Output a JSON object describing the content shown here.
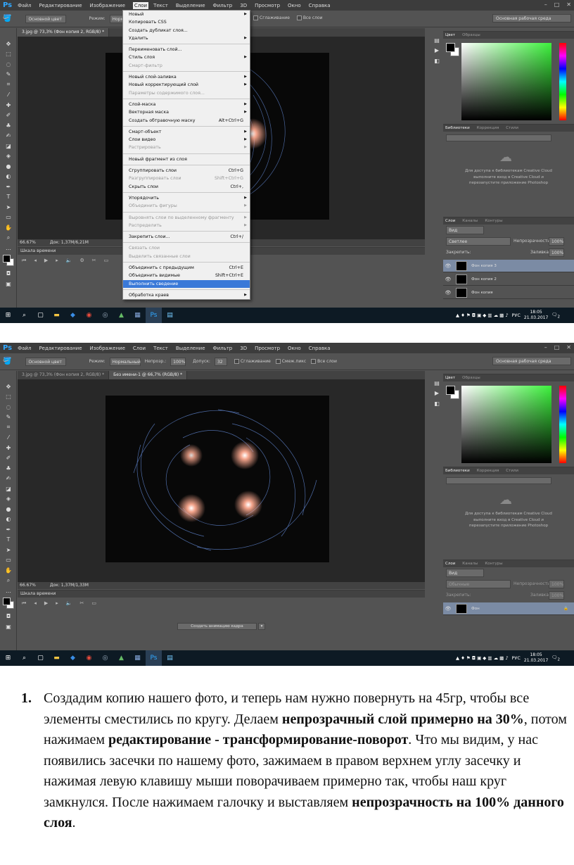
{
  "ps": {
    "logo": "Ps",
    "menu": [
      "Файл",
      "Редактирование",
      "Изображение",
      "Слои",
      "Текст",
      "Выделение",
      "Фильтр",
      "3D",
      "Просмотр",
      "Окно",
      "Справка"
    ],
    "window_buttons": [
      "–",
      "□",
      "✕"
    ]
  },
  "top": {
    "options": {
      "fill_select": "Основной цвет",
      "mode_label": "Режим:",
      "mode_value": "Норм",
      "smoothing_label": "Сглаживание",
      "all_layers_label": "Все слои",
      "workspace": "Основная рабочая среда"
    },
    "tab": "3.jpg @ 73,3% (Фон копия 2, RGB/8) *",
    "zoom": "66.67%",
    "doc_size": "Док: 1,37M/6,21M",
    "timeline_title": "Шкала времени",
    "dropdown": [
      {
        "label": "Новый",
        "arrow": true
      },
      {
        "label": "Копировать CSS"
      },
      {
        "label": "Создать дубликат слоя..."
      },
      {
        "label": "Удалить",
        "arrow": true
      },
      {
        "sep": true
      },
      {
        "label": "Переименовать слой..."
      },
      {
        "label": "Стиль слоя",
        "arrow": true
      },
      {
        "label": "Смарт-фильтр",
        "disabled": true
      },
      {
        "sep": true
      },
      {
        "label": "Новый слой-заливка",
        "arrow": true
      },
      {
        "label": "Новый корректирующий слой",
        "arrow": true
      },
      {
        "label": "Параметры содержимого слоя...",
        "disabled": true
      },
      {
        "sep": true
      },
      {
        "label": "Слой-маска",
        "arrow": true
      },
      {
        "label": "Векторная маска",
        "arrow": true
      },
      {
        "label": "Создать обтравочную маску",
        "shortcut": "Alt+Ctrl+G"
      },
      {
        "sep": true
      },
      {
        "label": "Смарт-объект",
        "arrow": true
      },
      {
        "label": "Слои видео",
        "arrow": true
      },
      {
        "label": "Растрировать",
        "arrow": true,
        "disabled": true
      },
      {
        "sep": true
      },
      {
        "label": "Новый фрагмент из слоя"
      },
      {
        "sep": true
      },
      {
        "label": "Сгруппировать слои",
        "shortcut": "Ctrl+G"
      },
      {
        "label": "Разгруппировать слои",
        "shortcut": "Shift+Ctrl+G",
        "disabled": true
      },
      {
        "label": "Скрыть слои",
        "shortcut": "Ctrl+,"
      },
      {
        "sep": true
      },
      {
        "label": "Упорядочить",
        "arrow": true
      },
      {
        "label": "Объединить фигуры",
        "arrow": true,
        "disabled": true
      },
      {
        "sep": true
      },
      {
        "label": "Выровнять слои по выделенному фрагменту",
        "arrow": true,
        "disabled": true
      },
      {
        "label": "Распределить",
        "arrow": true,
        "disabled": true
      },
      {
        "sep": true
      },
      {
        "label": "Закрепить слои...",
        "shortcut": "Ctrl+/"
      },
      {
        "sep": true
      },
      {
        "label": "Связать слои",
        "disabled": true
      },
      {
        "label": "Выделить связанные слои",
        "disabled": true
      },
      {
        "sep": true
      },
      {
        "label": "Объединить с предыдущим",
        "shortcut": "Ctrl+E"
      },
      {
        "label": "Объединить видимые",
        "shortcut": "Shift+Ctrl+E"
      },
      {
        "label": "Выполнить сведение",
        "highlighted": true
      },
      {
        "sep": true
      },
      {
        "label": "Обработка краев",
        "arrow": true
      }
    ],
    "panels": {
      "color_tabs": [
        "Цвет",
        "Образцы"
      ],
      "lib_tabs": [
        "Библиотеки",
        "Коррекция",
        "Стили"
      ],
      "cc_message": "Для доступа к библиотекам Creative Cloud выполните вход в Creative Cloud и перезапустите приложение Photoshop",
      "layers_tabs": [
        "Слои",
        "Каналы",
        "Контуры"
      ],
      "kind": "Вид",
      "blend": "Светлее",
      "opacity_label": "Непрозрачность:",
      "opacity": "100%",
      "lock_label": "Закрепить:",
      "fill_label": "Заливка:",
      "fill": "100%",
      "layers": [
        {
          "name": "Фон копия 3",
          "selected": true
        },
        {
          "name": "Фон копия 2",
          "selected": false
        },
        {
          "name": "Фон копия",
          "selected": false
        }
      ]
    }
  },
  "bottom": {
    "options": {
      "fill_select": "Основной цвет",
      "mode_label": "Режим:",
      "mode_value": "Нормальный",
      "opacity_label": "Непрозр.:",
      "opacity_value": "100%",
      "tolerance_label": "Допуск:",
      "tolerance_value": "32",
      "smoothing_label": "Сглаживание",
      "contiguous_label": "Смеж.пикс",
      "all_layers_label": "Все слои",
      "workspace": "Основная рабочая среда"
    },
    "tabs": [
      "3.jpg @ 73,3% (Фон копия 2, RGB/8) *",
      "Без имени-1 @ 66,7% (RGB/8) *"
    ],
    "zoom": "66.67%",
    "doc_size": "Док: 1,37M/1,33M",
    "timeline_title": "Шкала времени",
    "create_frames": "Создать анимацию кадра",
    "panels": {
      "color_tabs": [
        "Цвет",
        "Образцы"
      ],
      "lib_tabs": [
        "Библиотеки",
        "Коррекция",
        "Стили"
      ],
      "cc_message": "Для доступа к библиотекам Creative Cloud выполните вход в Creative Cloud и перезапустите приложение Photoshop",
      "layers_tabs": [
        "Слои",
        "Каналы",
        "Контуры"
      ],
      "kind": "Вид",
      "blend": "Обычные",
      "opacity_label": "Непрозрачность:",
      "opacity": "100%",
      "lock_label": "Закрепить:",
      "fill_label": "Заливка:",
      "fill": "100%",
      "layers": [
        {
          "name": "Фон",
          "selected": true
        }
      ]
    }
  },
  "taskbar": {
    "lang": "РУС",
    "time": "18:05",
    "date": "21.03.2017",
    "notif": "2"
  },
  "text": {
    "num": "1.",
    "p1": "Создадим копию нашего фото, и теперь нам нужно повернуть на 45гр, чтобы все элементы сместились по кругу. Делаем ",
    "b1": "непрозрачный слой примерно на 30%",
    "p2": ", потом нажимаем ",
    "b2": "редактирование - трансформирование-поворот",
    "p3": ". Что мы видим, у нас появились засечки по нашему фото, зажимаем в правом верхнем углу засечку и нажимая левую клавишу мыши поворачиваем примерно так, чтобы наш круг замкнулся. После нажимаем галочку и выставляем ",
    "b3": "непрозрачность на 100% данного слоя",
    "p4": "."
  }
}
